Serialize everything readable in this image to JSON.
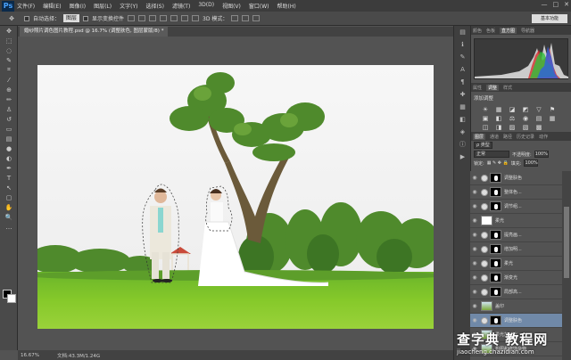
{
  "app": {
    "logo": "Ps"
  },
  "menu": [
    "文件(F)",
    "编辑(E)",
    "图像(I)",
    "图层(L)",
    "文字(Y)",
    "选择(S)",
    "滤镜(T)",
    "3D(D)",
    "视图(V)",
    "窗口(W)",
    "帮助(H)"
  ],
  "window_controls": [
    "—",
    "□",
    "✕"
  ],
  "options": {
    "auto_select": "自动选择：",
    "layer_select": "图层",
    "show_transform": "显示变换控件",
    "mode_3d": "3D 模式：",
    "workspace": "基本功能"
  },
  "document": {
    "tab_title": "婚纱照片调色图片教程.psd @ 16.7% (调整肤色, 图层蒙版/8) *",
    "zoom": "16.67%",
    "doc_size": "文档:43.3M/1.24G"
  },
  "right_panel": {
    "hist_tabs": [
      "颜色",
      "色板",
      "直方图",
      "导航器"
    ],
    "hist_active": "直方图",
    "adj_tabs": [
      "属性",
      "调整",
      "样式"
    ],
    "adj_active": "调整",
    "adj_title": "添加调整",
    "adj_icons": [
      "☀",
      "▦",
      "◪",
      "◩",
      "▽",
      "⚑",
      "",
      "▣",
      "◧",
      "⚖",
      "◉",
      "▤",
      "▦",
      "",
      "◫",
      "◨",
      "▨",
      "▧",
      "▩",
      "",
      ""
    ],
    "layer_tabs": [
      "图层",
      "通道",
      "路径",
      "历史记录",
      "动作"
    ],
    "layer_active": "图层",
    "kind": "ρ 类型",
    "blend_mode": "正常",
    "opacity_label": "不透明度:",
    "opacity": "100%",
    "lock_label": "锁定:",
    "fill_label": "填充:",
    "fill": "100%",
    "layers": [
      {
        "name": "调整肤色",
        "thumb": "adj",
        "mask": true,
        "selected": false
      },
      {
        "name": "整体色...",
        "thumb": "adj",
        "mask": true,
        "selected": false
      },
      {
        "name": "调节组...",
        "thumb": "adj",
        "mask": true,
        "selected": false
      },
      {
        "name": "柔光",
        "thumb": "white",
        "mask": false,
        "selected": false
      },
      {
        "name": "提亮画...",
        "thumb": "adj",
        "mask": true,
        "selected": false
      },
      {
        "name": "增加明...",
        "thumb": "adj",
        "mask": true,
        "selected": false
      },
      {
        "name": "柔光",
        "thumb": "adj",
        "mask": true,
        "selected": false
      },
      {
        "name": "渐变光",
        "thumb": "adj",
        "mask": true,
        "selected": false
      },
      {
        "name": "局部高...",
        "thumb": "adj",
        "mask": true,
        "selected": false
      },
      {
        "name": "盖印",
        "thumb": "img",
        "mask": false,
        "selected": false
      },
      {
        "name": "调整肤色",
        "thumb": "adj",
        "mask": true,
        "selected": true
      },
      {
        "name": "柔光加对比",
        "thumb": "img",
        "mask": false,
        "selected": false
      },
      {
        "name": "构图和修饰杂物",
        "thumb": "img",
        "mask": false,
        "selected": false
      }
    ]
  },
  "watermark": {
    "line1": "查字典 教程网",
    "line2": "jiaocheng.chazidian.com"
  },
  "colors": {
    "bg": "#535353",
    "panel_dark": "#3c3c3c",
    "selected_layer": "#7089a8",
    "sky": "#f3f3f3",
    "grass": "#7cc220"
  }
}
